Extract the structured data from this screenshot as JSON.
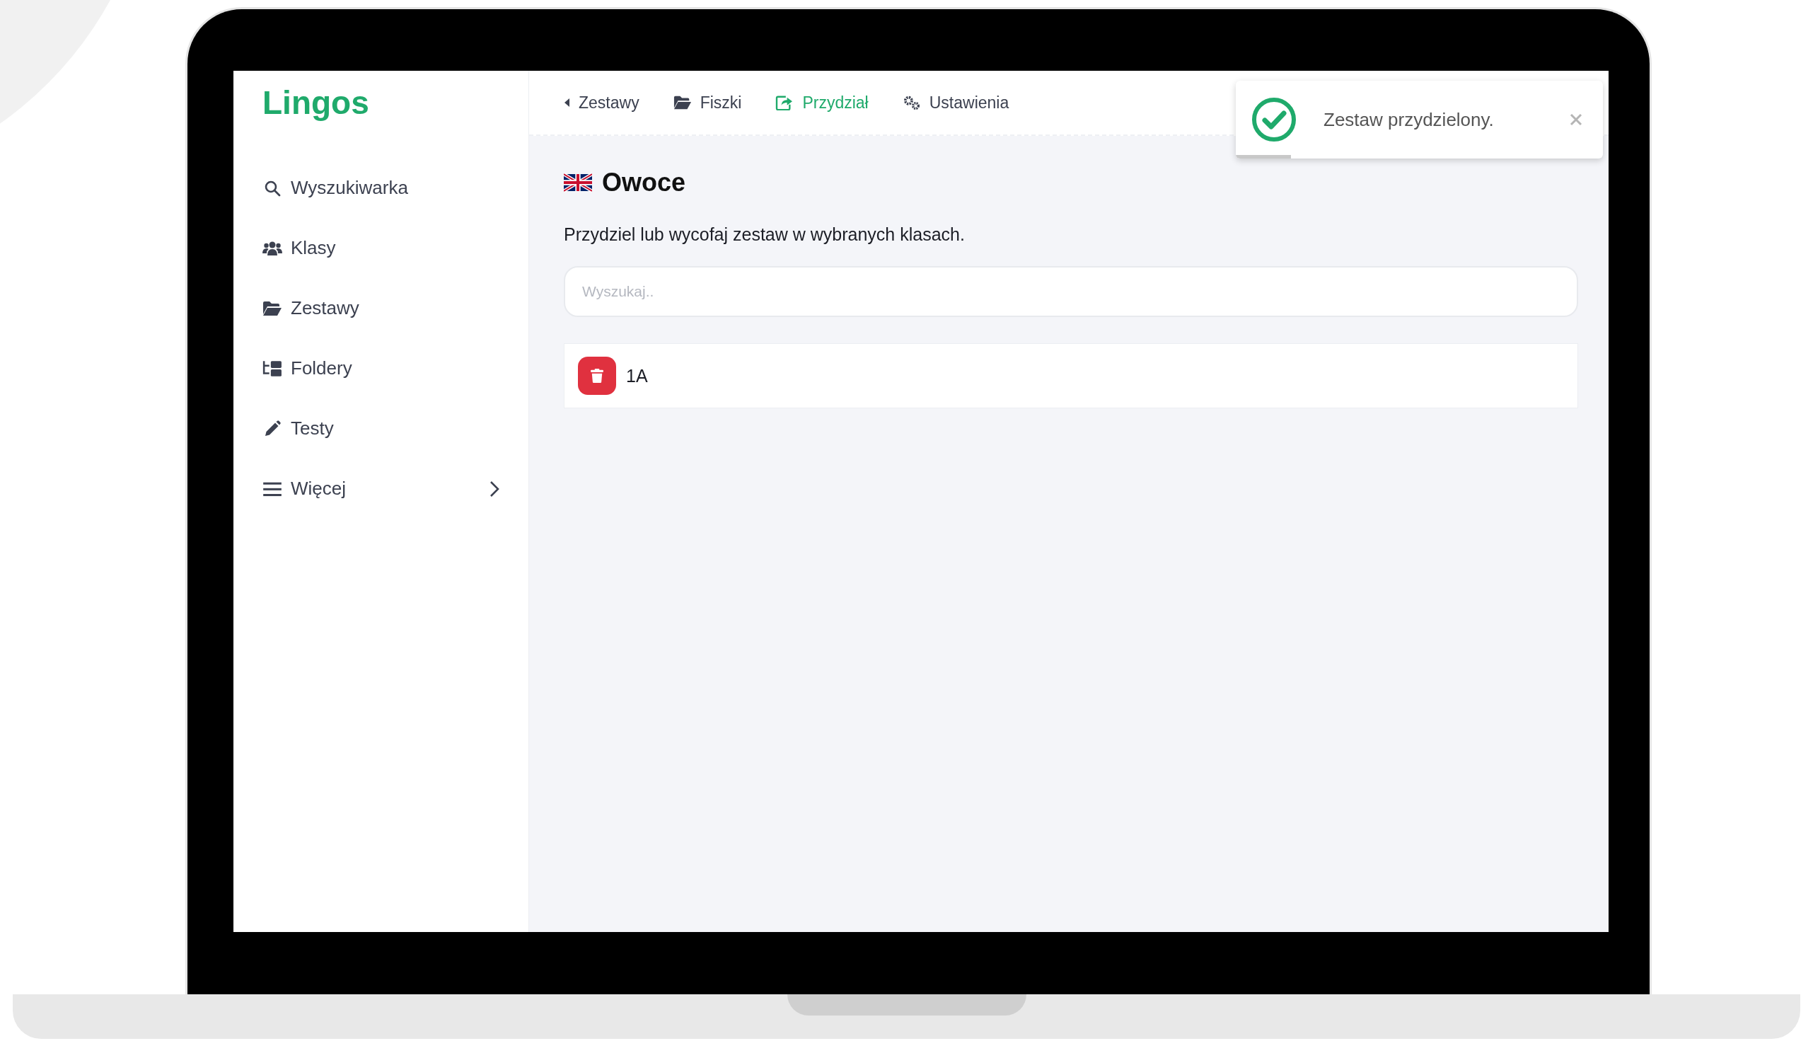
{
  "sidebar": {
    "logo": "Lingos",
    "items": [
      {
        "label": "Wyszukiwarka",
        "expandable": false
      },
      {
        "label": "Klasy",
        "expandable": false
      },
      {
        "label": "Zestawy",
        "expandable": false
      },
      {
        "label": "Foldery",
        "expandable": false
      },
      {
        "label": "Testy",
        "expandable": false
      },
      {
        "label": "Więcej",
        "expandable": true
      }
    ]
  },
  "tabs": [
    {
      "label": "Zestawy",
      "selected": false
    },
    {
      "label": "Fiszki",
      "selected": false
    },
    {
      "label": "Przydział",
      "selected": true
    },
    {
      "label": "Ustawienia",
      "selected": false
    }
  ],
  "page": {
    "title": "Owoce",
    "description": "Przydziel lub wycofaj zestaw w wybranych klasach.",
    "search": {
      "placeholder": "Wyszukaj.."
    },
    "classes": [
      {
        "name": "1A"
      }
    ]
  },
  "toast": {
    "message": "Zestaw przydzielony.",
    "level": 0.15
  }
}
